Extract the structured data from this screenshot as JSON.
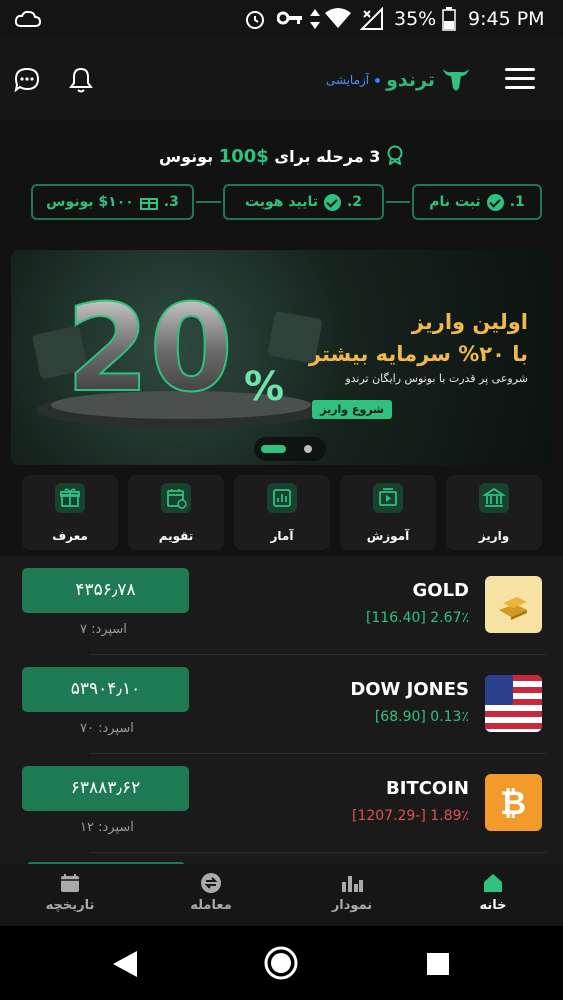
{
  "status_bar": {
    "battery": "35%",
    "time": "9:45 PM"
  },
  "header": {
    "brand": "ترندو",
    "mode_label": "آزمایشی"
  },
  "bonus": {
    "title_prefix": "3 مرحله برای",
    "amount": "$100",
    "title_suffix": "بونوس",
    "steps": [
      {
        "num": "1.",
        "label": "ثبت نام"
      },
      {
        "num": "2.",
        "label": "تایید هویت"
      },
      {
        "num": "3.",
        "label": "$۱۰۰ بونوس"
      }
    ]
  },
  "banner": {
    "big_text": "20",
    "percent": "%",
    "line1": "اولین واریز",
    "line2": "با ۲۰% سرمایه بیشتر",
    "subtext": "شروعی پر قدرت با بونوس رایگان ترندو",
    "cta": "شروع واریز"
  },
  "quick_actions": [
    {
      "label": "واریز",
      "icon": "bank-icon"
    },
    {
      "label": "آموزش",
      "icon": "video-icon"
    },
    {
      "label": "آمار",
      "icon": "stats-icon"
    },
    {
      "label": "تقویم",
      "icon": "calendar-icon"
    },
    {
      "label": "معرف",
      "icon": "gift-icon"
    }
  ],
  "market": [
    {
      "name": "GOLD",
      "change": "[116.40] 2.67٪",
      "direction": "up",
      "price": "۴۳۵۶٫۷۸",
      "spread": "اسپرد: ۷"
    },
    {
      "name": "DOW JONES",
      "change": "[68.90] 0.13٪",
      "direction": "up",
      "price": "۵۳۹۰۴٫۱۰",
      "spread": "اسپرد: ۷۰"
    },
    {
      "name": "BITCOIN",
      "change": "[1207.29-] 1.89٪",
      "direction": "down",
      "price": "۶۳۸۸۳٫۶۲",
      "spread": "اسپرد: ۱۲"
    }
  ],
  "bottom_nav": [
    {
      "label": "خانه",
      "active": true
    },
    {
      "label": "نمودار",
      "active": false
    },
    {
      "label": "معامله",
      "active": false
    },
    {
      "label": "تاریخچه",
      "active": false
    }
  ],
  "colors": {
    "accent": "#2ec27e",
    "accent_dark": "#1e7a52",
    "gold_text": "#f0b94a",
    "down": "#e05252",
    "background": "#121212"
  }
}
